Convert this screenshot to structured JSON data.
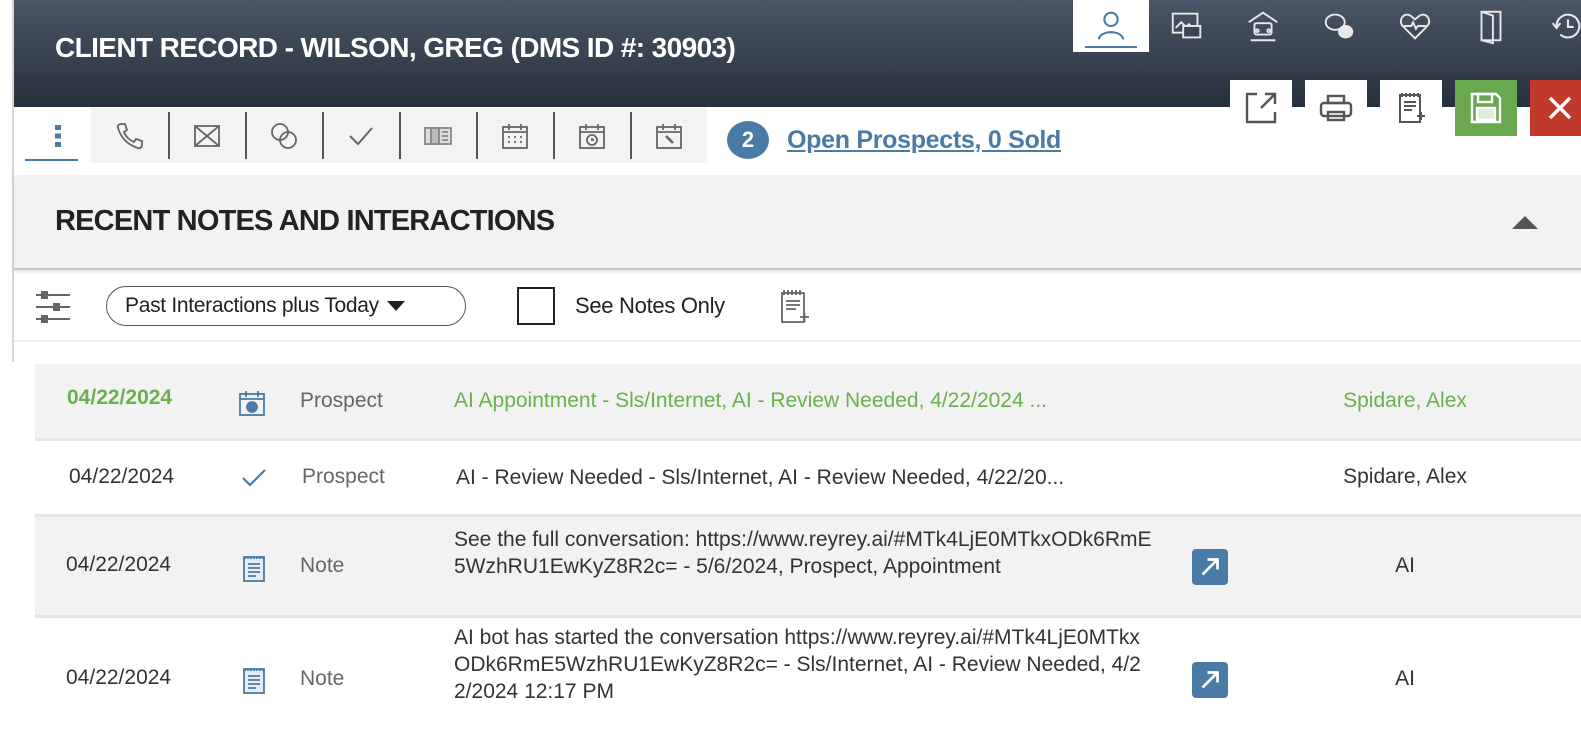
{
  "header": {
    "title": "CLIENT RECORD - WILSON, GREG (DMS ID #: 30903)",
    "top_icons": [
      "person-icon",
      "image-gallery-icon",
      "vehicle-garage-icon",
      "chat-bubbles-icon",
      "heart-pulse-icon",
      "door-icon",
      "history-icon"
    ],
    "active_top_icon": "person-icon",
    "actions": [
      "open-external-icon",
      "print-icon",
      "add-note-icon",
      "save-icon",
      "close-icon"
    ]
  },
  "tabs": [
    "more-vertical-icon",
    "phone-icon",
    "email-icon",
    "chat-icon",
    "check-icon",
    "fax-icon",
    "calendar-icon",
    "calendar-clock-icon",
    "calendar-tool-icon"
  ],
  "prospects": {
    "count": "2",
    "link_text": "Open Prospects, 0 Sold"
  },
  "section": {
    "title": "RECENT NOTES AND INTERACTIONS",
    "filter_value": "Past Interactions plus Today",
    "checkbox_label": "See Notes Only",
    "checkbox_checked": false
  },
  "colors": {
    "header_bg": "#2f3946",
    "accent_blue": "#4a7ba6",
    "highlight_green": "#6ab04c",
    "save_green": "#6aa84f",
    "close_red": "#c0392b"
  },
  "rows": [
    {
      "date": "04/22/2024",
      "icon": "calendar-appointment-icon",
      "type": "Prospect",
      "description": "AI Appointment - Sls/Internet, AI - Review Needed, 4/22/2024 ...",
      "has_link": false,
      "user": "Spidare, Alex",
      "highlight": true
    },
    {
      "date": "04/22/2024",
      "icon": "check-icon",
      "type": "Prospect",
      "description": "AI - Review Needed - Sls/Internet, AI - Review Needed, 4/22/20...",
      "has_link": false,
      "user": "Spidare, Alex",
      "highlight": false
    },
    {
      "date": "04/22/2024",
      "icon": "note-icon",
      "type": "Note",
      "description": "See the full conversation: https://www.reyrey.ai/#MTk4LjE0MTkxODk6RmE5WzhRU1EwKyZ8R2c= - 5/6/2024, Prospect, Appointment",
      "has_link": true,
      "user": "AI",
      "highlight": false
    },
    {
      "date": "04/22/2024",
      "icon": "note-icon",
      "type": "Note",
      "description": "AI bot has started the conversation https://www.reyrey.ai/#MTk4LjE0MTkxODk6RmE5WzhRU1EwKyZ8R2c= - Sls/Internet, AI - Review Needed, 4/22/2024 12:17 PM",
      "has_link": true,
      "user": "AI",
      "highlight": false
    }
  ]
}
